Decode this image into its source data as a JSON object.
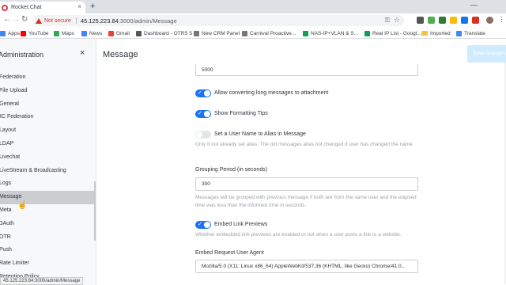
{
  "browser": {
    "tab_title": "Rocket.Chat",
    "tab_close": "×",
    "new_tab": "+",
    "window_minimize": "—",
    "security_label": "Not secure",
    "url_host": "45.125.223.84",
    "url_path": ":3000/admin/Message",
    "status_url": "45.125.223.84:3000/admin/Message",
    "bookmarks": [
      "Apps",
      "YouTube",
      "Maps",
      "News",
      "Gmail",
      "Dashboard - OTRS 5",
      "New CRM Panel",
      "Carnival Proactive...",
      "NAS-IP+VLAN & S...",
      "Real IP List - Googl...",
      "Imported",
      "Translate"
    ]
  },
  "sidebar": {
    "title": "Administration",
    "close_label": "×",
    "items": [
      "Federation",
      "File Upload",
      "General",
      "IRC Federation",
      "Layout",
      "LDAP",
      "Livechat",
      "LiveStream & Broadcasting",
      "Logs",
      "Message",
      "Meta",
      "OAuth",
      "OTR",
      "Push",
      "Rate Limiter",
      "Retention Policy"
    ],
    "active_index": 9
  },
  "main": {
    "title": "Message",
    "save_label": "Save changes",
    "top_input_value": "5000",
    "settings": {
      "long_messages": {
        "label": "Allow converting long messages to attachment",
        "on": true
      },
      "formatting_tips": {
        "label": "Show Formatting Tips",
        "on": true
      },
      "alias": {
        "label": "Set a User Name to Alias in Message",
        "on": false,
        "hint": "Only if not already set alias. The old messages alias not changed if user has changed the name."
      },
      "grouping": {
        "label": "Grouping Period (in seconds)",
        "value": "300",
        "hint": "Messages will be grouped with previous message if both are from the same user and the elapsed time was less than the informed time in seconds."
      },
      "embed_previews": {
        "label": "Embed Link Previews",
        "on": true,
        "hint": "Whether embedded link previews are enabled or not when a user posts a link to a website."
      },
      "user_agent": {
        "label": "Embed Request User Agent",
        "value": "Mozilla/5.0 (X11; Linux x86_64) AppleWebKit/537.36 (KHTML, like Gecko) Chrome/41.0..."
      }
    }
  },
  "colors": {
    "accent": "#1d74f5",
    "save_button_disabled": "#d1ebfe",
    "sidebar_bg": "#f7f8fa",
    "active_item_bg": "#cbced1",
    "warning_red": "#d93025"
  }
}
